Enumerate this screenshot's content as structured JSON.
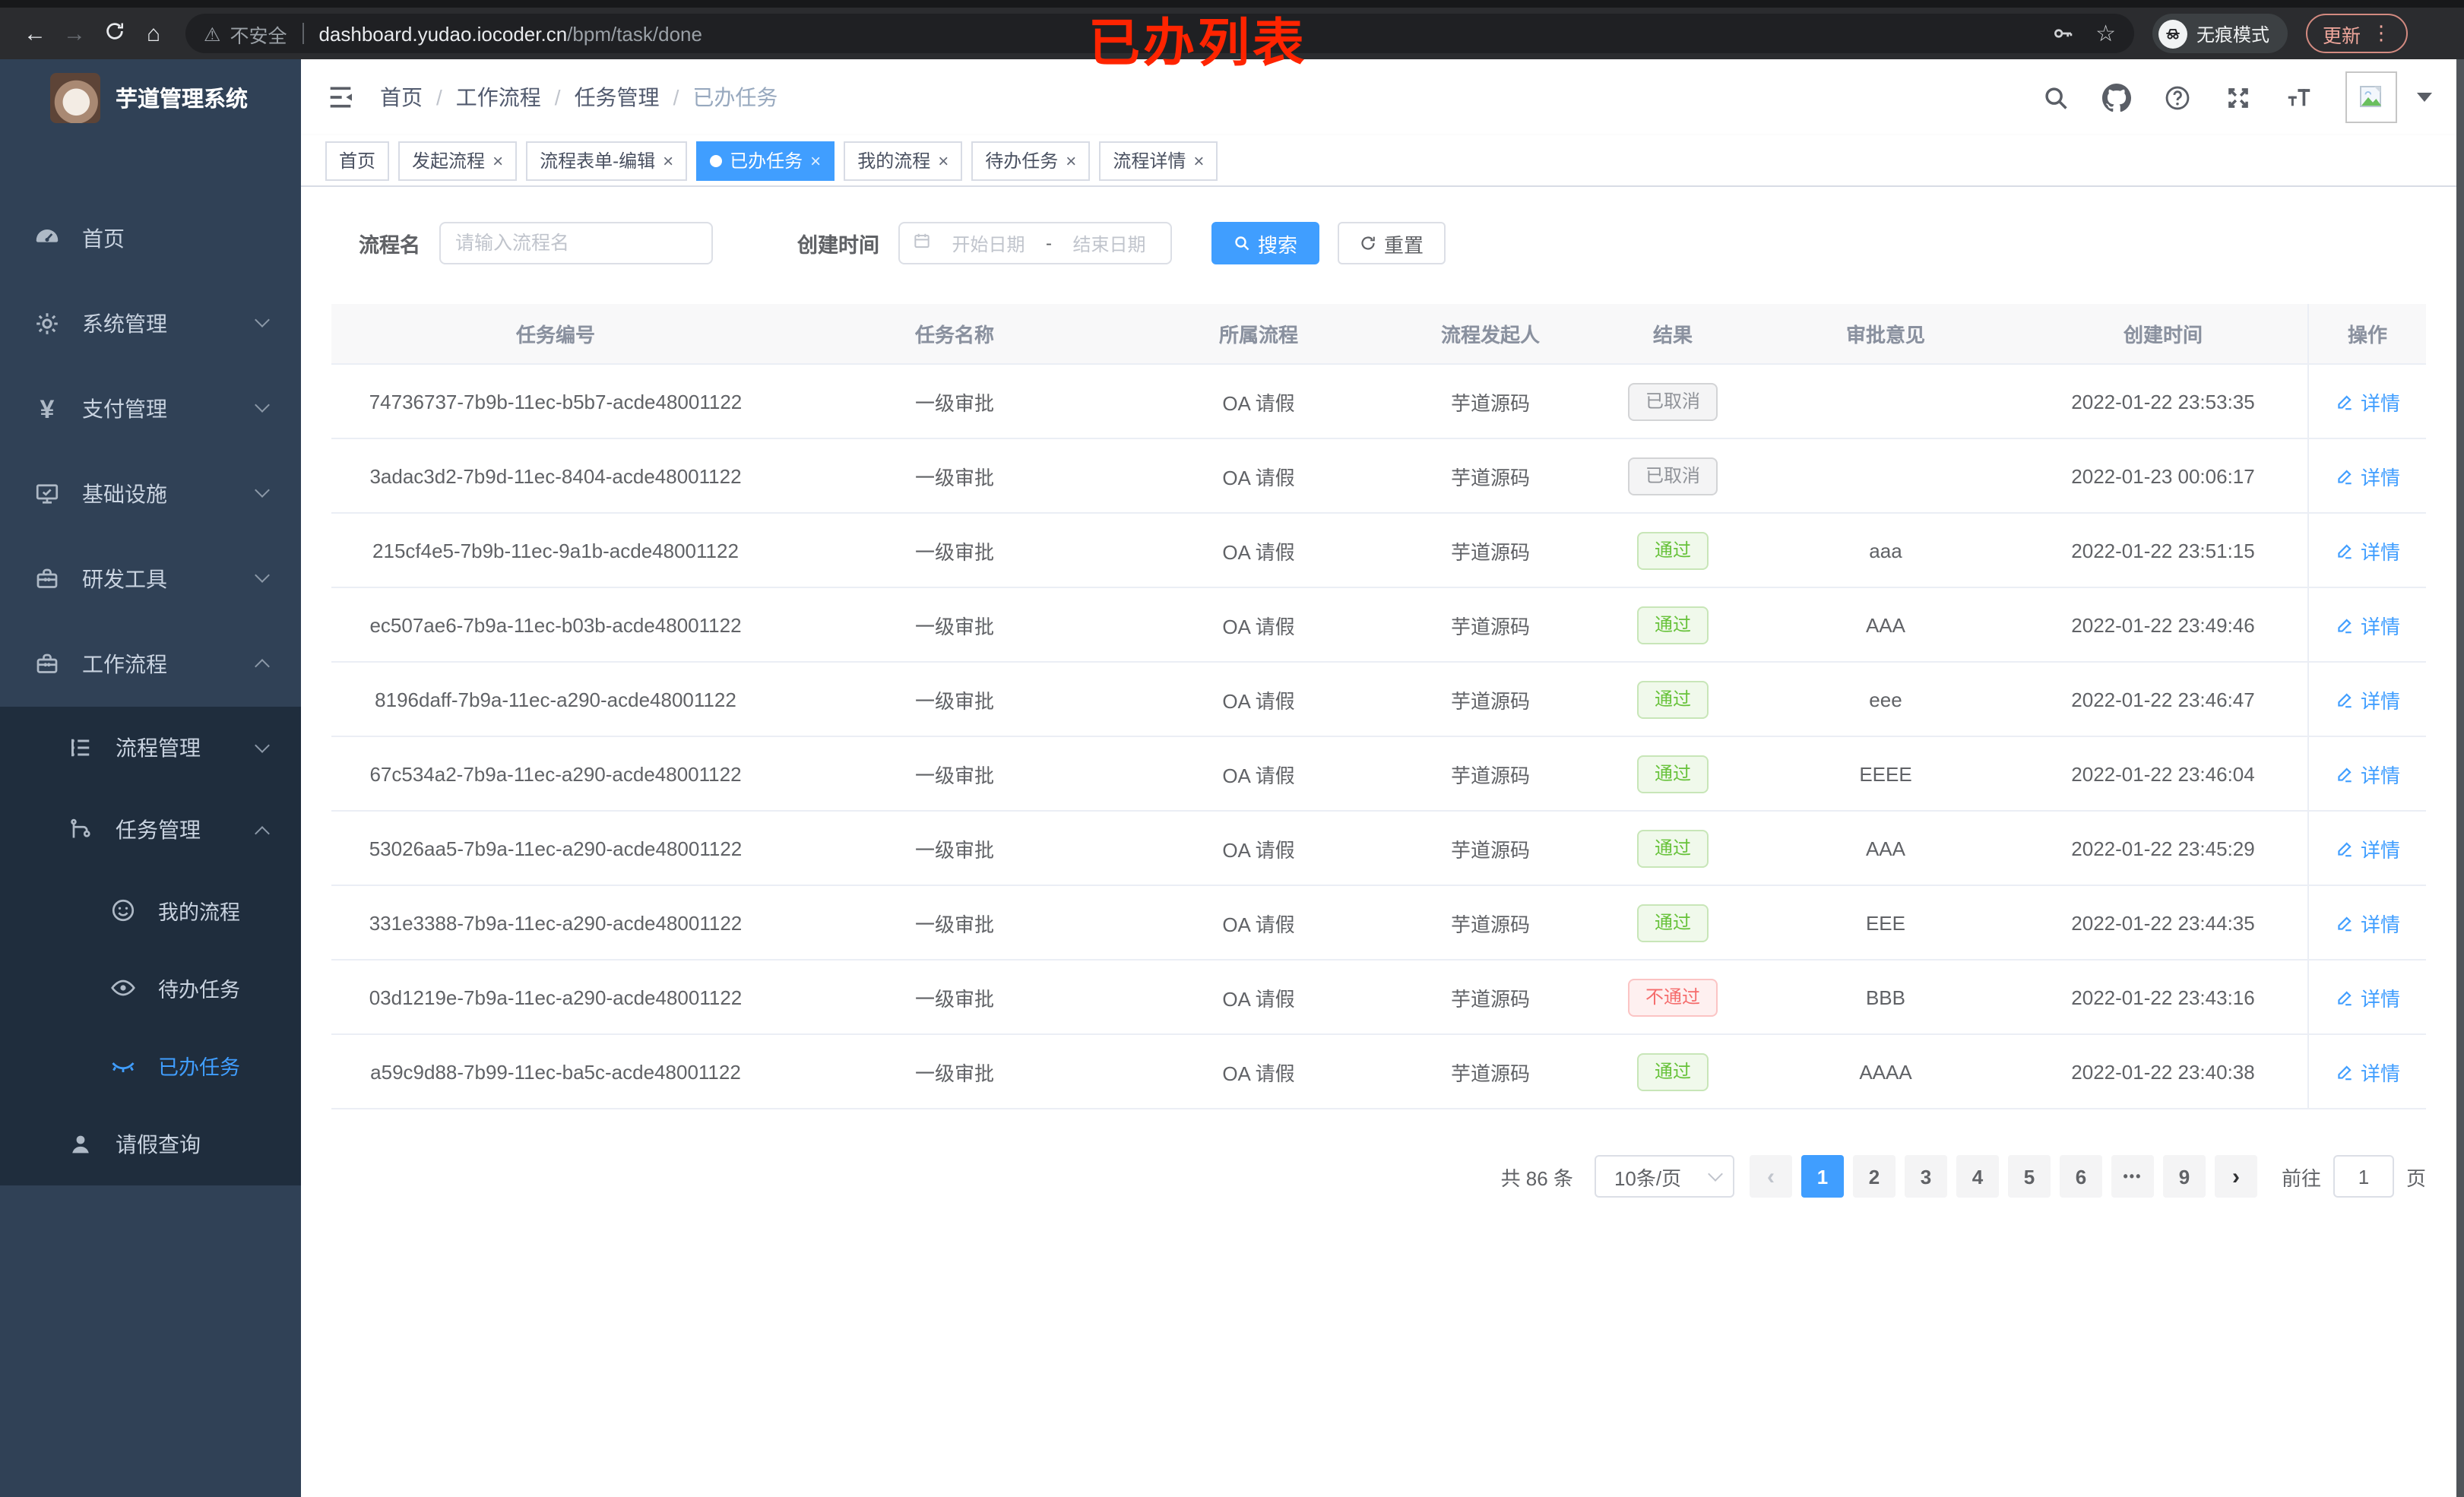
{
  "annotation": {
    "title": "已办列表",
    "color": "#ff2400"
  },
  "browser": {
    "security_label": "不安全",
    "url_host": "dashboard.yudao.iocoder.cn",
    "url_path": "/bpm/task/done",
    "incognito_label": "无痕模式",
    "update_label": "更新"
  },
  "sidebar": {
    "app_title": "芋道管理系统",
    "items": [
      {
        "label": "首页",
        "icon": "dashboard-icon",
        "level": 1
      },
      {
        "label": "系统管理",
        "icon": "gear-icon",
        "level": 1,
        "expanded": false
      },
      {
        "label": "支付管理",
        "icon": "yen-icon",
        "level": 1,
        "expanded": false
      },
      {
        "label": "基础设施",
        "icon": "monitor-icon",
        "level": 1,
        "expanded": false
      },
      {
        "label": "研发工具",
        "icon": "toolbox-icon",
        "level": 1,
        "expanded": false
      },
      {
        "label": "工作流程",
        "icon": "toolbox-icon",
        "level": 1,
        "expanded": true
      },
      {
        "label": "流程管理",
        "icon": "tree-list-icon",
        "level": 2,
        "expanded": false
      },
      {
        "label": "任务管理",
        "icon": "flow-icon",
        "level": 2,
        "expanded": true
      },
      {
        "label": "我的流程",
        "icon": "face-icon",
        "level": 3,
        "active": false
      },
      {
        "label": "待办任务",
        "icon": "eye-open-icon",
        "level": 3,
        "active": false
      },
      {
        "label": "已办任务",
        "icon": "eye-closed-icon",
        "level": 3,
        "active": true
      },
      {
        "label": "请假查询",
        "icon": "user-icon",
        "level": 2,
        "active": false
      }
    ]
  },
  "header": {
    "breadcrumb": [
      "首页",
      "工作流程",
      "任务管理",
      "已办任务"
    ],
    "separator": "/"
  },
  "tabs": {
    "close_glyph": "×",
    "items": [
      {
        "label": "首页",
        "closable": false,
        "active": false
      },
      {
        "label": "发起流程",
        "closable": true,
        "active": false
      },
      {
        "label": "流程表单-编辑",
        "closable": true,
        "active": false
      },
      {
        "label": "已办任务",
        "closable": true,
        "active": true
      },
      {
        "label": "我的流程",
        "closable": true,
        "active": false
      },
      {
        "label": "待办任务",
        "closable": true,
        "active": false
      },
      {
        "label": "流程详情",
        "closable": true,
        "active": false
      }
    ]
  },
  "filters": {
    "name_label": "流程名",
    "name_placeholder": "请输入流程名",
    "time_label": "创建时间",
    "start_placeholder": "开始日期",
    "range_separator": "-",
    "end_placeholder": "结束日期",
    "search_label": "搜索",
    "reset_label": "重置"
  },
  "table": {
    "columns": [
      "任务编号",
      "任务名称",
      "所属流程",
      "流程发起人",
      "结果",
      "审批意见",
      "创建时间",
      "操作"
    ],
    "action_label": "详情",
    "rows": [
      {
        "id": "74736737-7b9b-11ec-b5b7-acde48001122",
        "name": "一级审批",
        "process": "OA 请假",
        "starter": "芋道源码",
        "result": "已取消",
        "result_type": "cancelled",
        "comment": "",
        "time": "2022-01-22 23:53:35"
      },
      {
        "id": "3adac3d2-7b9d-11ec-8404-acde48001122",
        "name": "一级审批",
        "process": "OA 请假",
        "starter": "芋道源码",
        "result": "已取消",
        "result_type": "cancelled",
        "comment": "",
        "time": "2022-01-23 00:06:17"
      },
      {
        "id": "215cf4e5-7b9b-11ec-9a1b-acde48001122",
        "name": "一级审批",
        "process": "OA 请假",
        "starter": "芋道源码",
        "result": "通过",
        "result_type": "pass",
        "comment": "aaa",
        "time": "2022-01-22 23:51:15"
      },
      {
        "id": "ec507ae6-7b9a-11ec-b03b-acde48001122",
        "name": "一级审批",
        "process": "OA 请假",
        "starter": "芋道源码",
        "result": "通过",
        "result_type": "pass",
        "comment": "AAA",
        "time": "2022-01-22 23:49:46"
      },
      {
        "id": "8196daff-7b9a-11ec-a290-acde48001122",
        "name": "一级审批",
        "process": "OA 请假",
        "starter": "芋道源码",
        "result": "通过",
        "result_type": "pass",
        "comment": "eee",
        "time": "2022-01-22 23:46:47"
      },
      {
        "id": "67c534a2-7b9a-11ec-a290-acde48001122",
        "name": "一级审批",
        "process": "OA 请假",
        "starter": "芋道源码",
        "result": "通过",
        "result_type": "pass",
        "comment": "EEEE",
        "time": "2022-01-22 23:46:04"
      },
      {
        "id": "53026aa5-7b9a-11ec-a290-acde48001122",
        "name": "一级审批",
        "process": "OA 请假",
        "starter": "芋道源码",
        "result": "通过",
        "result_type": "pass",
        "comment": "AAA",
        "time": "2022-01-22 23:45:29"
      },
      {
        "id": "331e3388-7b9a-11ec-a290-acde48001122",
        "name": "一级审批",
        "process": "OA 请假",
        "starter": "芋道源码",
        "result": "通过",
        "result_type": "pass",
        "comment": "EEE",
        "time": "2022-01-22 23:44:35"
      },
      {
        "id": "03d1219e-7b9a-11ec-a290-acde48001122",
        "name": "一级审批",
        "process": "OA 请假",
        "starter": "芋道源码",
        "result": "不通过",
        "result_type": "fail",
        "comment": "BBB",
        "time": "2022-01-22 23:43:16"
      },
      {
        "id": "a59c9d88-7b99-11ec-ba5c-acde48001122",
        "name": "一级审批",
        "process": "OA 请假",
        "starter": "芋道源码",
        "result": "通过",
        "result_type": "pass",
        "comment": "AAAA",
        "time": "2022-01-22 23:40:38"
      }
    ]
  },
  "pagination": {
    "total_text": "共 86 条",
    "page_size": "10条/页",
    "prev_glyph": "‹",
    "next_glyph": "›",
    "pages": [
      "1",
      "2",
      "3",
      "4",
      "5",
      "6",
      "•••",
      "9"
    ],
    "goto_label": "前往",
    "goto_value": "1",
    "unit_label": "页"
  },
  "colors": {
    "accent": "#409eff",
    "pass": "#67c23a",
    "fail": "#f56c6c",
    "cancelled": "#909399",
    "sidebar_bg": "#304156",
    "submenu_bg": "#1f2d3d"
  }
}
